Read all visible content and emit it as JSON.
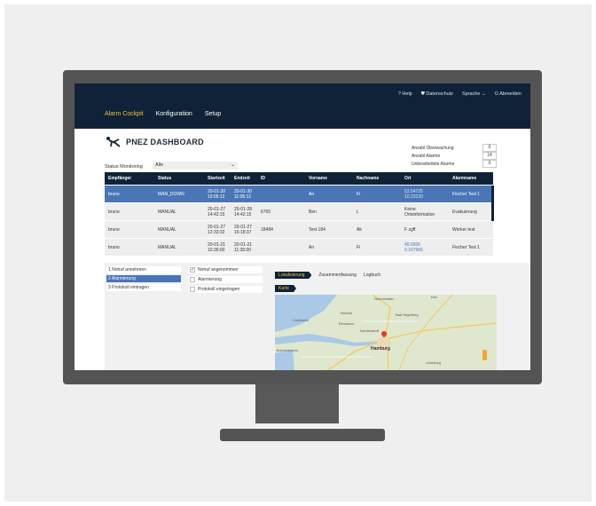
{
  "topnav": {
    "help": "? Help",
    "privacy": "Datenschutz",
    "language": "Sprache",
    "logout": "Abmelden"
  },
  "mainnav": {
    "items": [
      "Alarm Cockpit",
      "Konfiguration",
      "Setup"
    ],
    "active": "Alarm Cockpit"
  },
  "page": {
    "title": "PNEZ DASHBOARD"
  },
  "counts": [
    {
      "label": "Anzahl Überwachung",
      "value": "0"
    },
    {
      "label": "Anzahl Alarme",
      "value": "14"
    },
    {
      "label": "Unbearbeitete Alarme",
      "value": "0"
    }
  ],
  "status_monitoring": {
    "label": "Status Monitoring",
    "value": "Alle"
  },
  "table": {
    "headers": [
      "Empfänger",
      "Status",
      "Startzeit",
      "Endzeit",
      "ID",
      "Vorname",
      "Nachname",
      "Ort",
      "Alarmname"
    ],
    "rows": [
      [
        "bruno",
        "MAN_DOWN",
        "20-01-30\n10:05:12",
        "20-01-30\n11:05:12",
        "",
        "An",
        "Fi",
        "53.54725\n10.23130",
        "Fischer Test 1"
      ],
      [
        "bruno",
        "MANUAL",
        "20-01-27\n14:42:15",
        "20-01-28\n14:42:15",
        "6765",
        "Ben",
        "L",
        "Keine\nOrtsinformation",
        "Evakuierung"
      ],
      [
        "bruno",
        "MANUAL",
        "20-01-27\n12:33:32",
        "20-01-27\n16:18:37",
        "18484",
        "Test 184",
        "Ak",
        "F zgff",
        "Worker test"
      ],
      [
        "bruno",
        "MANUAL",
        "20-01-21\n10:35:00",
        "20-01-21\n11:35:00",
        "",
        "An",
        "Fi",
        "49.5606\n9.167966",
        "Fischer Test 1"
      ]
    ]
  },
  "steps": [
    "1 Notruf annehmen",
    "2 Alarmierung",
    "3 Protokoll eintragen"
  ],
  "checks": [
    {
      "label": "Notruf angenommen",
      "checked": true
    },
    {
      "label": "Alarmierung",
      "checked": false
    },
    {
      "label": "Protokoll eingetragen",
      "checked": false
    }
  ],
  "detail_tabs": [
    "Lokalisierung",
    "Zusammenfassung",
    "Logbuch"
  ],
  "map": {
    "tab": "Karte",
    "places": [
      "Neumünster",
      "Kiel",
      "Cuxhaven",
      "Itzehoe",
      "Bad Segeberg",
      "Norderstedt",
      "Elmshorn",
      "Hamburg",
      "Bremerhaven",
      "Lüneburg"
    ]
  },
  "colors": {
    "navy": "#0f2238",
    "accent": "#f2c23c",
    "selected": "#4a76b6"
  }
}
